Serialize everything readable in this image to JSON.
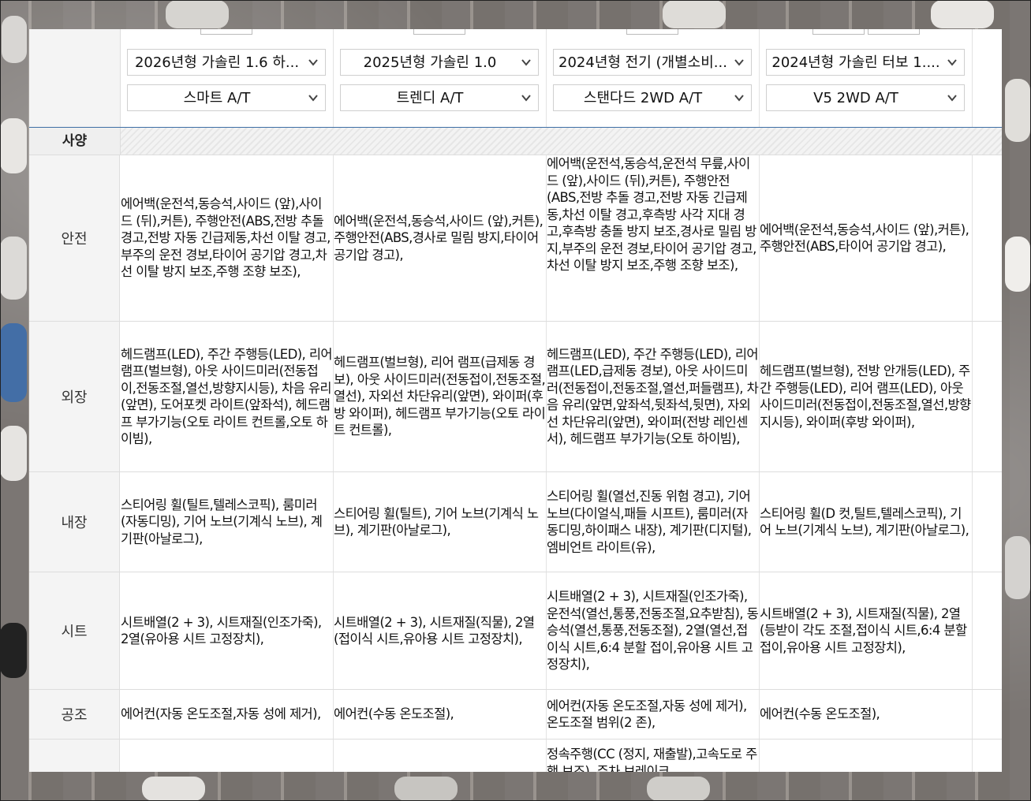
{
  "header": {
    "columns": [
      {
        "model": "2026년형 가솔린 1.6 하...",
        "trim": "스마트 A/T"
      },
      {
        "model": "2025년형 가솔린 1.0",
        "trim": "트렌디 A/T"
      },
      {
        "model": "2024년형 전기 (개별소비...",
        "trim": "스탠다드 2WD A/T"
      },
      {
        "model": "2024년형 가솔린 터보 1....",
        "trim": "V5 2WD A/T"
      }
    ]
  },
  "section": {
    "label": "사양"
  },
  "rows": [
    {
      "label": "안전",
      "cells": [
        "에어백(운전석,동승석,사이드 (앞),사이드 (뒤),커튼), 주행안전(ABS,전방 추돌 경고,전방 자동 긴급제동,차선 이탈 경고,부주의 운전 경보,타이어 공기압 경고,차선 이탈 방지 보조,주행 조향 보조),",
        "에어백(운전석,동승석,사이드 (앞),커튼), 주행안전(ABS,경사로 밀림 방지,타이어 공기압 경고),",
        "에어백(운전석,동승석,운전석 무릎,사이드 (앞),사이드 (뒤),커튼), 주행안전(ABS,전방 추돌 경고,전방 자동 긴급제동,차선 이탈 경고,후측방 사각 지대 경고,후측방 충돌 방지 보조,경사로 밀림 방지,부주의 운전 경보,타이어 공기압 경고,차선 이탈 방지 보조,주행 조향 보조),",
        "에어백(운전석,동승석,사이드 (앞),커튼), 주행안전(ABS,타이어 공기압 경고),"
      ]
    },
    {
      "label": "외장",
      "cells": [
        "헤드램프(LED), 주간 주행등(LED), 리어 램프(벌브형), 아웃 사이드미러(전동접이,전동조절,열선,방향지시등), 차음 유리(앞면), 도어포켓 라이트(앞좌석), 헤드램프 부가기능(오토 라이트 컨트롤,오토 하이빔),",
        "헤드램프(벌브형), 리어 램프(급제동 경보), 아웃 사이드미러(전동접이,전동조절,열선), 자외선 차단유리(앞면), 와이퍼(후방 와이퍼), 헤드램프 부가기능(오토 라이트 컨트롤),",
        "헤드램프(LED), 주간 주행등(LED), 리어 램프(LED,급제동 경보), 아웃 사이드미러(전동접이,전동조절,열선,퍼들램프), 차음 유리(앞면,앞좌석,뒷좌석,뒷면), 자외선 차단유리(앞면), 와이퍼(전방 레인센서), 헤드램프 부가기능(오토 하이빔),",
        "헤드램프(벌브형), 전방 안개등(LED), 주간 주행등(LED), 리어 램프(LED), 아웃 사이드미러(전동접이,전동조절,열선,방향지시등), 와이퍼(후방 와이퍼),"
      ]
    },
    {
      "label": "내장",
      "cells": [
        "스티어링 휠(틸트,텔레스코픽), 룸미러(자동디밍), 기어 노브(기계식 노브), 계기판(아날로그),",
        "스티어링 휠(틸트), 기어 노브(기계식 노브), 계기판(아날로그),",
        "스티어링 휠(열선,진동 위험 경고), 기어 노브(다이얼식,패들 시프트), 룸미러(자동디밍,하이패스 내장), 계기판(디지털), 엠비언트 라이트(유),",
        "스티어링 휠(D 컷,틸트,텔레스코픽), 기어 노브(기계식 노브), 계기판(아날로그),"
      ]
    },
    {
      "label": "시트",
      "cells": [
        "시트배열(2 + 3), 시트재질(인조가죽), 2열(유아용 시트 고정장치),",
        "시트배열(2 + 3), 시트재질(직물), 2열(접이식 시트,유아용 시트 고정장치),",
        "시트배열(2 + 3), 시트재질(인조가죽), 운전석(열선,통풍,전동조절,요추받침), 동승석(열선,통풍,전동조절), 2열(열선,접이식 시트,6:4 분할 접이,유아용 시트 고정장치),",
        "시트배열(2 + 3), 시트재질(직물), 2열(등받이 각도 조절,접이식 시트,6:4 분할 접이,유아용 시트 고정장치),"
      ]
    },
    {
      "label": "공조",
      "cells": [
        "에어컨(자동 온도조절,자동 성에 제거),",
        "에어컨(수동 온도조절),",
        "에어컨(자동 온도조절,자동 성에 제거), 온도조절 범위(2 존),",
        "에어컨(수동 온도조절),"
      ]
    },
    {
      "label": "",
      "cells": [
        "",
        "",
        "정속주행(CC (정지, 재출발),고속도로 주행 보조), 주차 브레이크",
        ""
      ]
    }
  ],
  "icons": {
    "dropdown": "chevron-down-icon"
  }
}
